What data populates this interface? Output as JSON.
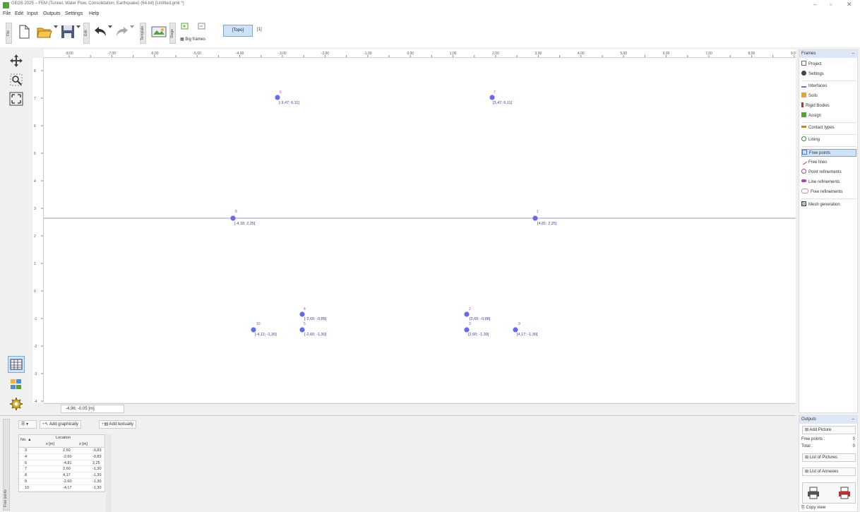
{
  "window": {
    "title": "GEO5 2025 – FEM (Tunnel, Water Flow, Consolidation, Earthquake) (64-bit) [Untitled.gmk *]",
    "min": "–",
    "max": "▫",
    "close": "✕"
  },
  "menu": [
    "File",
    "Edit",
    "Input",
    "Outputs",
    "Settings",
    "Help"
  ],
  "toolbar": {
    "topo_label": "[Topo]",
    "stage_label": "[1]",
    "vlabel_file": "File",
    "vlabel_edit": "Edit",
    "vlabel_template": "Template",
    "vlabel_stage": "Stage",
    "bigframe_label": "Big frames"
  },
  "ruler": {
    "top_ticks": [
      "-8,00",
      "-7,50",
      "-7,00",
      "-6,50",
      "-6,00",
      "-5,50",
      "-5,00",
      "-4,50",
      "-4,00",
      "-3,50",
      "-3,00",
      "-2,50",
      "-2,00",
      "-1,50",
      "-1,00",
      "-0,50",
      "0,00",
      "0,50",
      "1,00",
      "1,50",
      "2,00",
      "2,50",
      "3,00",
      "3,50",
      "4,00",
      "4,50",
      "5,00",
      "5,50",
      "6,00",
      "6,50",
      "7,00",
      "7,50",
      "8,00",
      "8,50",
      "9,00",
      "9,50"
    ],
    "left_ticks": [
      "8",
      "7",
      "6",
      "5",
      "4",
      "3",
      "2",
      "1",
      "0",
      "-1",
      "-2",
      "-3",
      "-4"
    ]
  },
  "points": [
    {
      "num": "6",
      "label": "[-3,47; 6,11]"
    },
    {
      "num": "7",
      "label": "[3,47; 6,11]"
    },
    {
      "num": "8",
      "label": "[-4,18; 2,25]"
    },
    {
      "num": "1",
      "label": "[4,81; 2,25]"
    },
    {
      "num": "4",
      "label": "[-2,60; -0,88]"
    },
    {
      "num": "2",
      "label": "[2,60; -0,88]"
    },
    {
      "num": "10",
      "label": "[-4,11; -1,30]"
    },
    {
      "num": "5",
      "label": "[-2,60; -1,30]"
    },
    {
      "num": "3",
      "label": "[2,60; -1,30]"
    },
    {
      "num": "9",
      "label": "[4,17; -1,30]"
    }
  ],
  "status": {
    "coords": "-4,96; -0,05 [m]"
  },
  "frames": {
    "title": "Frames",
    "items": [
      "Project",
      "Settings",
      "Interfaces",
      "Soils",
      "Rigid Bodies",
      "Assign",
      "Contact types",
      "Lining",
      "Free points",
      "Free lines",
      "Point refinements",
      "Line refinements",
      "Free refinements",
      "Mesh generation"
    ]
  },
  "bottom": {
    "side_label": "Free points",
    "add_graphically": "Add graphically",
    "add_textually": "Add textually",
    "table": {
      "col_no": "No. ▲",
      "col_location": "Location",
      "col_x": "x [m]",
      "col_z": "z [m]",
      "rows": [
        {
          "no": "3",
          "x": "2,60",
          "z": "-0,83"
        },
        {
          "no": "4",
          "x": "-2,60",
          "z": "-0,83"
        },
        {
          "no": "6",
          "x": "-4,81",
          "z": "2,25"
        },
        {
          "no": "7",
          "x": "2,60",
          "z": "-1,30"
        },
        {
          "no": "8",
          "x": "4,17",
          "z": "-1,30"
        },
        {
          "no": "9",
          "x": "-2,60",
          "z": "-1,30"
        },
        {
          "no": "10",
          "x": "-4,17",
          "z": "-1,30"
        }
      ]
    }
  },
  "outputs": {
    "title": "Outputs",
    "add_picture": "Add Picture",
    "free_points_label": "Free points :",
    "free_points_value": "0",
    "total_label": "Total :",
    "total_value": "0",
    "list_of_pictures": "List of Pictures",
    "list_of_annexes": "List of Annexes",
    "copy_view": "Copy view"
  },
  "colors": {
    "point": "#6a6ae8",
    "accent": "#cde3f7",
    "interface": "#8080d0"
  }
}
